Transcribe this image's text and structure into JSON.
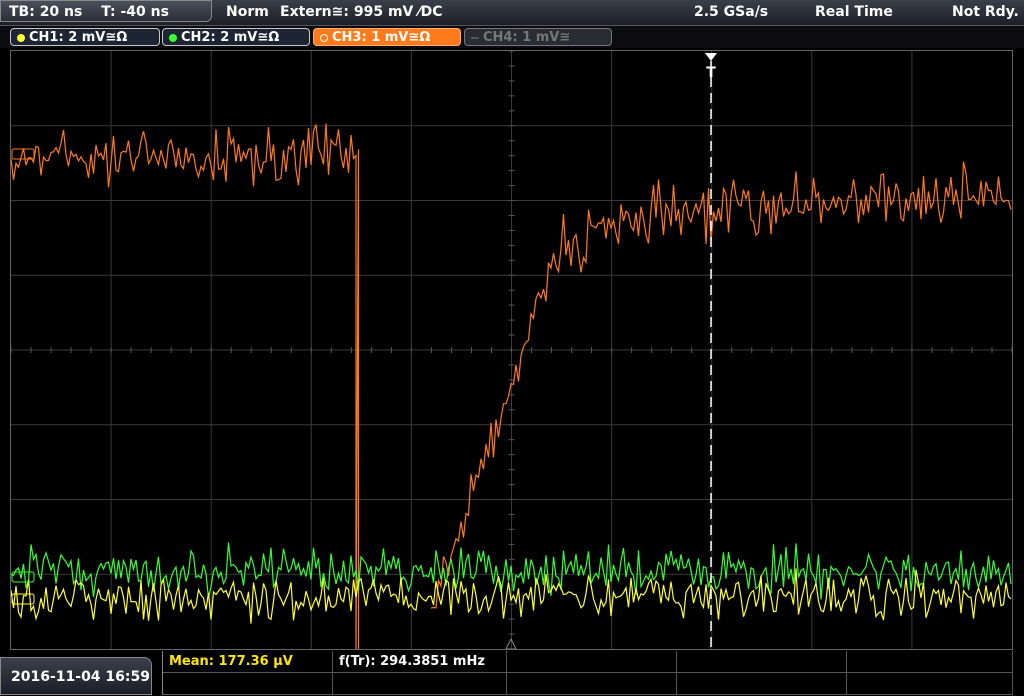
{
  "topbar": {
    "tb_label": "TB: 20 ns",
    "t_label": "T: -40 ns",
    "mode": "Norm",
    "trigger": "Extern≅: 995 mV ⁄DC",
    "sample_rate": "2.5 GSa/s",
    "acq_mode": "Real Time",
    "status": "Not Rdy."
  },
  "channels": [
    {
      "label": "CH1: 2 mV≅Ω",
      "color": "#ffff33"
    },
    {
      "label": "CH2: 2 mV≅Ω",
      "color": "#33ff33"
    },
    {
      "label": "CH3: 1 mV≅Ω",
      "color": "#ff7a1a"
    },
    {
      "label": "CH4: 1 mV≅",
      "color": "#777777"
    }
  ],
  "trigger_marker": "T",
  "footer": {
    "datetime": "2016-11-04 16:59",
    "mean_label": "Mean: 177.36 µV",
    "freq_label": "f(Tr): 294.3851 mHz"
  },
  "colors": {
    "ch1": "#ffff33",
    "ch2": "#33ff33",
    "ch3": "#ff7a1a",
    "grid": "#3a3a3a"
  }
}
